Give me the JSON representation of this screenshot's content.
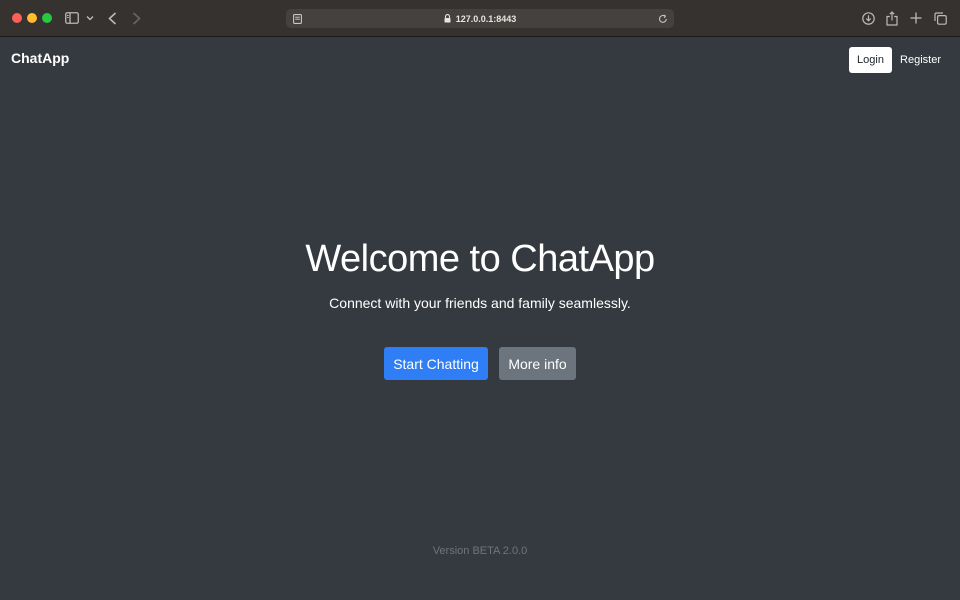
{
  "browser": {
    "address": "127.0.0.1:8443",
    "icons": {
      "sidebar": "sidebar-icon",
      "chevron": "chevron-down-icon",
      "back": "back-icon",
      "forward": "forward-icon",
      "page_menu": "page-menu-icon",
      "lock": "lock-icon",
      "reload": "reload-icon",
      "download": "download-icon",
      "share": "share-icon",
      "new_tab": "plus-icon",
      "tab_overview": "tabs-overview-icon"
    }
  },
  "navbar": {
    "brand": "ChatApp",
    "login_label": "Login",
    "register_label": "Register"
  },
  "hero": {
    "title": "Welcome to ChatApp",
    "subtitle": "Connect with your friends and family seamlessly.",
    "primary_label": "Start Chatting",
    "secondary_label": "More info"
  },
  "footer": {
    "version": "Version BETA 2.0.0"
  },
  "colors": {
    "page_background": "#343a40",
    "primary": "#2f7ef6",
    "secondary": "#6c757d",
    "muted_text": "#6c757d"
  }
}
